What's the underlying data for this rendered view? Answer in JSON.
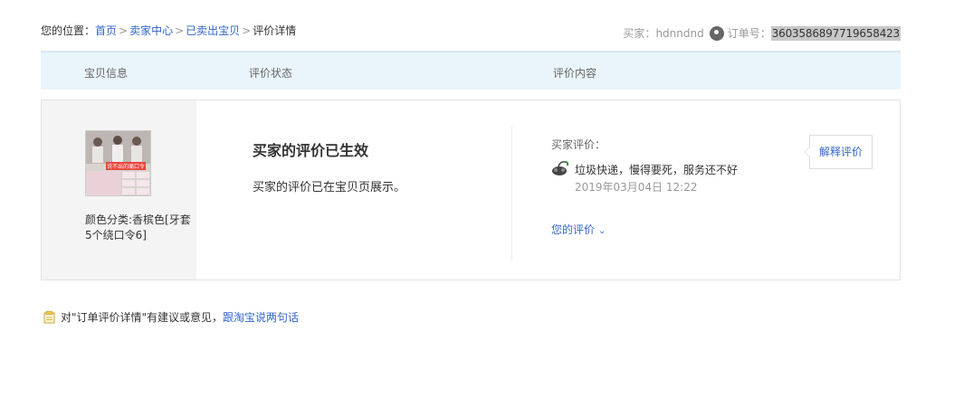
{
  "breadcrumb": {
    "prefix": "您的位置：",
    "items": [
      "首页",
      "卖家中心",
      "已卖出宝贝"
    ],
    "current": "评价详情",
    "separator": ">"
  },
  "order_meta": {
    "buyer_label": "买家：",
    "buyer_name": "hdnndnd",
    "order_label": "订单号：",
    "order_no": "3603586897719658423"
  },
  "table_head": {
    "item": "宝贝信息",
    "status": "评价状态",
    "content": "评价内容"
  },
  "item": {
    "thumb_caption": "说不出的痛口令",
    "sku": "颜色分类:香槟色[牙套5个绕口令6]"
  },
  "status": {
    "title": "买家的评价已生效",
    "desc": "买家的评价已在宝贝页展示。"
  },
  "review": {
    "label": "买家评价：",
    "text": "垃圾快递，慢得要死，服务还不好",
    "time": "2019年03月04日 12:22",
    "my_rate_label": "您的评价",
    "explain_button": "解释评价"
  },
  "feedback": {
    "text": "对\"订单评价详情\"有建议或意见，",
    "link": "跟淘宝说两句话"
  },
  "colors": {
    "link": "#3366cc",
    "header_bg": "#eaf4fb",
    "item_col_bg": "#f4f4f4"
  }
}
